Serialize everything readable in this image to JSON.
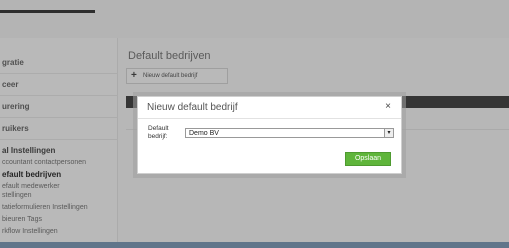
{
  "sidebar": {
    "items": [
      {
        "label": "gratie"
      },
      {
        "label": "ceer"
      },
      {
        "label": "urering"
      },
      {
        "label": "ruikers"
      }
    ],
    "section_title": "al Instellingen",
    "sub_items": [
      {
        "label": "ccountant contactpersonen"
      },
      {
        "label": "efault bedrijven"
      },
      {
        "label": "efault medewerker"
      },
      {
        "label": "stellingen"
      },
      {
        "label": "tatieformulieren Instellingen"
      },
      {
        "label": "bieuren Tags"
      },
      {
        "label": "rkflow Instellingen"
      }
    ]
  },
  "main": {
    "title": "Default bedrijven",
    "new_button_label": "Nieuw default bedrijf",
    "new_button_icon": "plus-icon"
  },
  "modal": {
    "title": "Nieuw default bedrijf",
    "close_glyph": "×",
    "field_label": "Default bedrijf:",
    "selected_value": "Demo BV",
    "save_label": "Opslaan"
  },
  "colors": {
    "save_button": "#5fb53b",
    "table_header": "#2d2d2d"
  }
}
